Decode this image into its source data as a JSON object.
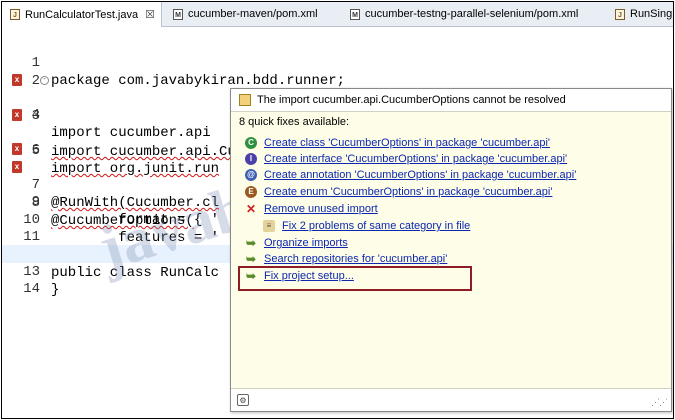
{
  "tabs": [
    {
      "label": "RunCalculatorTest.java",
      "close": "☒",
      "icon": "java-file-icon"
    },
    {
      "label": "cucumber-maven/pom.xml",
      "icon": "maven-pom-icon"
    },
    {
      "label": "cucumber-testng-parallel-selenium/pom.xml",
      "icon": "maven-pom-icon"
    },
    {
      "label": "RunSing",
      "icon": "java-file-icon"
    }
  ],
  "editor": {
    "lines": [
      {
        "num": "1",
        "text": "package com.javabykiran.bdd.runner;"
      },
      {
        "num": "2",
        "text": ""
      },
      {
        "num": "3",
        "text": "import cucumber.api.CucumberOptions;",
        "error": true,
        "fold": true
      },
      {
        "num": "4",
        "text": "import cucumber.api"
      },
      {
        "num": "5",
        "text": "import org.junit.run",
        "error": true
      },
      {
        "num": "6",
        "text": ""
      },
      {
        "num": "7",
        "text": "@RunWith(Cucumber.cl",
        "error": true
      },
      {
        "num": "8",
        "text": "@CucumberOptions(",
        "error": true
      },
      {
        "num": "9",
        "text": "        format = { '"
      },
      {
        "num": "10",
        "text": "        features = '"
      },
      {
        "num": "11",
        "text": "}"
      },
      {
        "num": "12",
        "text": "public class RunCalc"
      },
      {
        "num": "13",
        "text": "}"
      },
      {
        "num": "14",
        "text": ""
      }
    ]
  },
  "watermark": {
    "main": "javabykiran",
    "sub": "Tutorials"
  },
  "popup": {
    "header": "The import cucumber.api.CucumberOptions cannot be resolved",
    "count": "8 quick fixes available:",
    "fixes": [
      {
        "label": "Create class 'CucumberOptions' in package 'cucumber.api'",
        "icon": "create-class-icon"
      },
      {
        "label": "Create interface 'CucumberOptions' in package 'cucumber.api'",
        "icon": "create-interface-icon"
      },
      {
        "label": "Create annotation 'CucumberOptions' in package 'cucumber.api'",
        "icon": "create-annotation-icon"
      },
      {
        "label": "Create enum 'CucumberOptions' in package 'cucumber.api'",
        "icon": "create-enum-icon"
      },
      {
        "label": "Remove unused import",
        "icon": "remove-icon"
      },
      {
        "label": "Fix 2 problems of same category in file",
        "icon": "fix-multiple-icon"
      },
      {
        "label": "Organize imports",
        "icon": "arrow-fix-icon"
      },
      {
        "label": "Search repositories for 'cucumber.api'",
        "icon": "arrow-fix-icon"
      },
      {
        "label": "Fix project setup...",
        "icon": "arrow-fix-icon"
      }
    ],
    "highlight_color": "#8c1d24"
  }
}
